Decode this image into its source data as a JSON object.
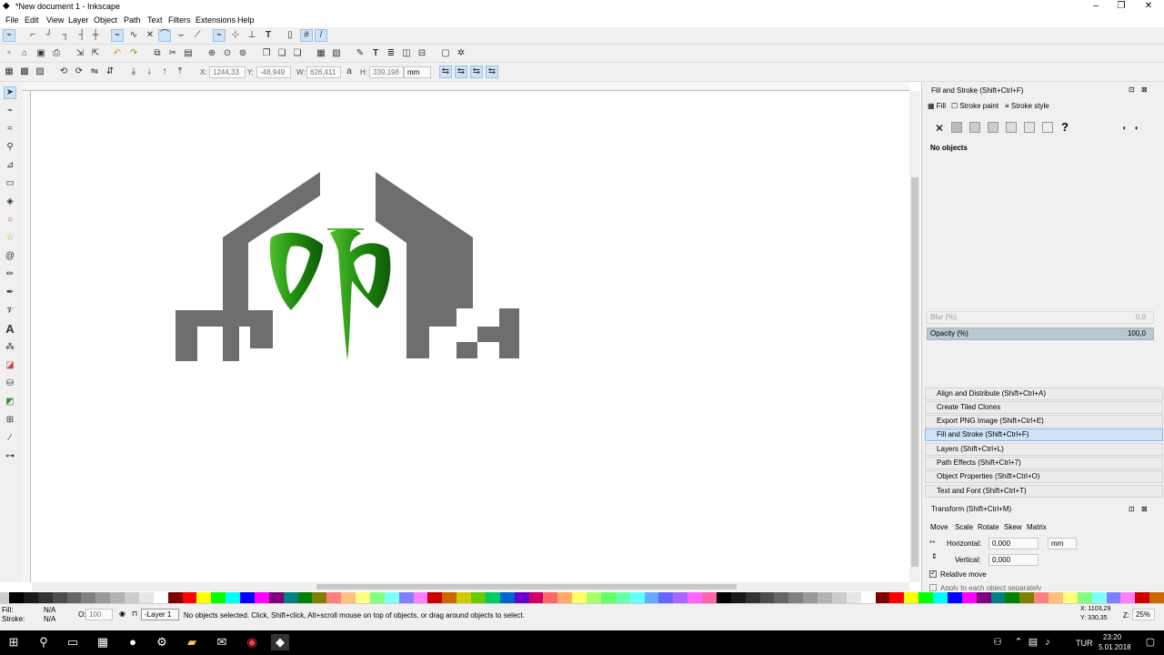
{
  "window": {
    "title": "*New document 1 - Inkscape",
    "min_icon": "minimize-icon",
    "max_icon": "maximize-icon",
    "close_icon": "close-icon"
  },
  "menus": [
    "File",
    "Edit",
    "View",
    "Layer",
    "Object",
    "Path",
    "Text",
    "Filters",
    "Extensions",
    "Help"
  ],
  "controls": {
    "x_label": "X:",
    "x_value": "1244,33",
    "y_label": "Y:",
    "y_value": "-48,949",
    "w_label": "W:",
    "w_value": "626,411",
    "h_label": "H:",
    "h_value": "339,198",
    "unit": "mm"
  },
  "fill_stroke": {
    "title": "Fill and Stroke (Shift+Ctrl+F)",
    "tabs": [
      "Fill",
      "Stroke paint",
      "Stroke style"
    ],
    "status": "No objects",
    "blur_label": "Blur (%)",
    "blur_value": "0,0",
    "opacity_label": "Opacity (%)",
    "opacity_value": "100,0"
  },
  "docked_dialogs": [
    "Align and Distribute (Shift+Ctrl+A)",
    "Create Tiled Clones",
    "Export PNG Image (Shift+Ctrl+E)",
    "Fill and Stroke (Shift+Ctrl+F)",
    "Layers (Shift+Ctrl+L)",
    "Path Effects  (Shift+Ctrl+7)",
    "Object Properties (Shift+Ctrl+O)",
    "Text and Font (Shift+Ctrl+T)"
  ],
  "transform": {
    "title": "Transform (Shift+Ctrl+M)",
    "tabs": [
      "Move",
      "Scale",
      "Rotate",
      "Skew",
      "Matrix"
    ],
    "horizontal_label": "Horizontal:",
    "horizontal_value": "0,000",
    "vertical_label": "Vertical:",
    "vertical_value": "0,000",
    "unit": "mm",
    "relative_move": "Relative move",
    "apply_each": "Apply to each object separately"
  },
  "status": {
    "fill_label": "Fill:",
    "fill_value": "N/A",
    "stroke_label": "Stroke:",
    "stroke_value": "N/A",
    "o_label": "O:",
    "o_value": "100",
    "layer": "-Layer 1",
    "message": "No objects selected. Click, Shift+click, Alt+scroll mouse on top of objects, or drag around objects to select.",
    "cursor_x": "X: 1103,29",
    "cursor_y": "Y:  330,35",
    "z_label": "Z:",
    "zoom": "25%"
  },
  "taskbar": {
    "lang": "TUR",
    "time": "23:20",
    "date": "5.01.2018"
  },
  "colors": {
    "house_gray": "#6e6e6e",
    "logo_green": "#1f8a10",
    "logo_green_light": "#4fc02c",
    "selection_blue": "#cfe3f7"
  }
}
